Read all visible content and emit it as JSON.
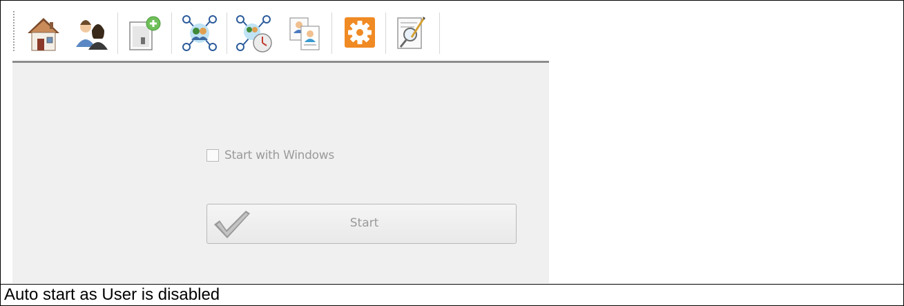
{
  "toolbar": {
    "buttons": [
      {
        "icon": "home-icon"
      },
      {
        "icon": "users-icon"
      },
      {
        "icon": "add-document-icon"
      },
      {
        "icon": "network-group-icon"
      },
      {
        "icon": "network-schedule-icon"
      },
      {
        "icon": "user-documents-icon"
      },
      {
        "icon": "settings-gear-icon",
        "active": true,
        "accent": "#f08a24"
      },
      {
        "icon": "search-report-icon"
      }
    ]
  },
  "panel": {
    "checkbox_label": "Start with Windows",
    "checkbox_checked": false,
    "start_button_label": "Start",
    "disabled_text_color": "#9a9a9a"
  },
  "caption": "Auto start as User is disabled"
}
